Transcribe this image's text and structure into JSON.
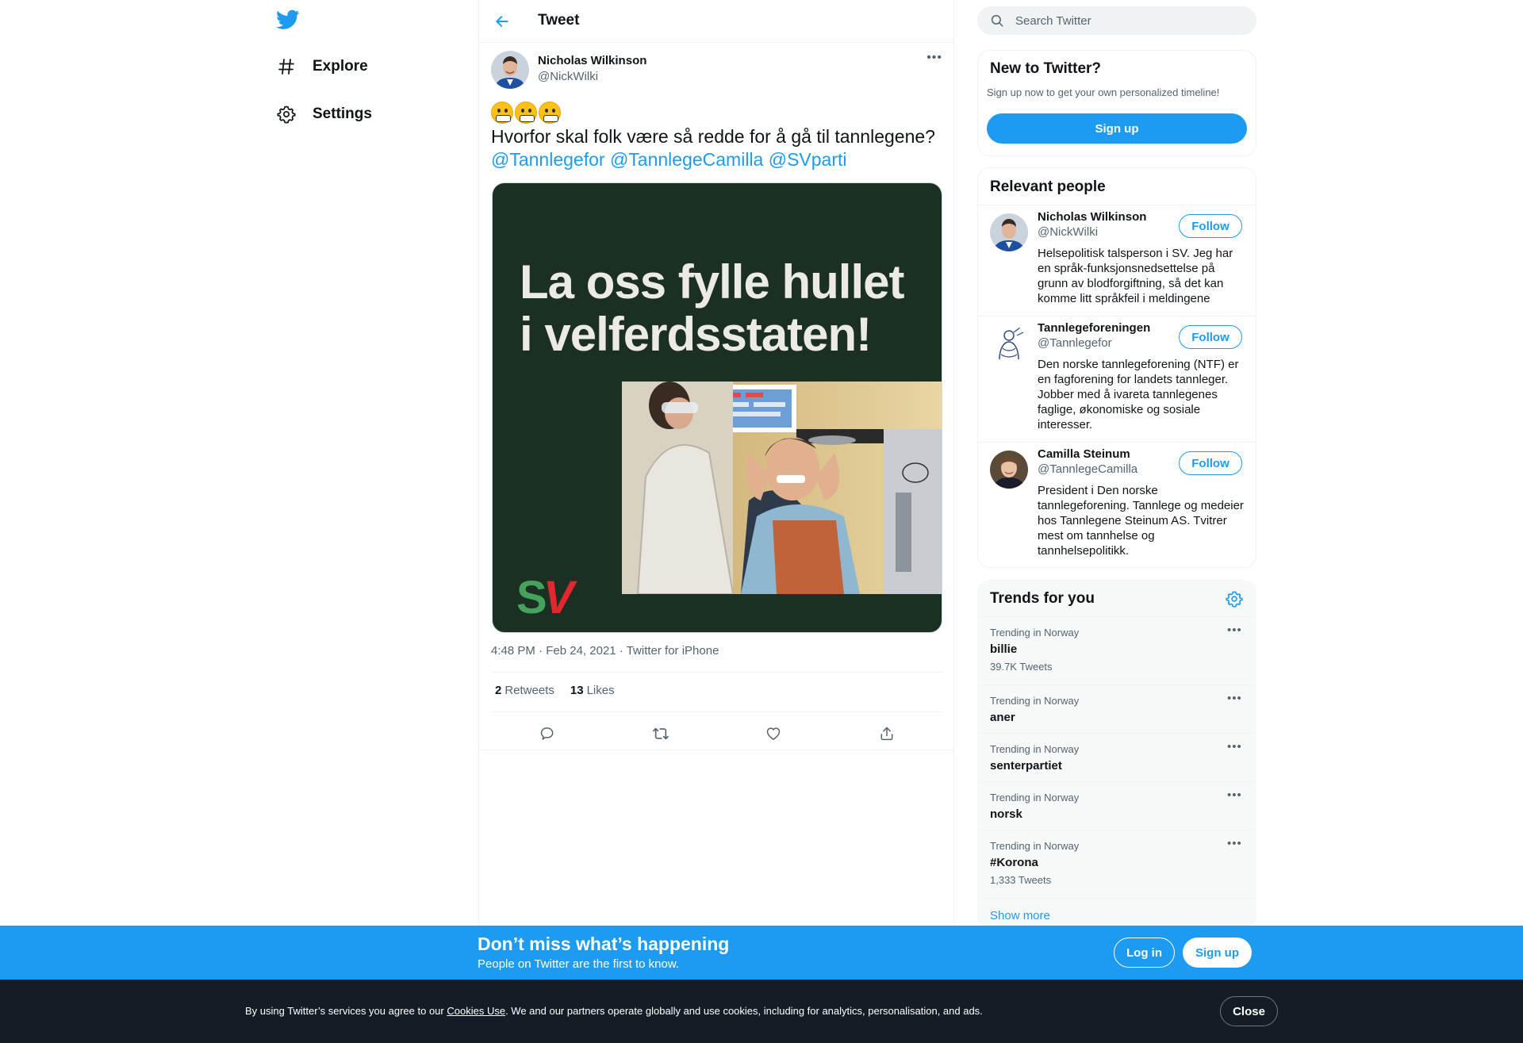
{
  "colors": {
    "brand": "#1d9bf0",
    "text": "#0f1419",
    "secondary": "#536471",
    "cookie_bg": "#141d26"
  },
  "nav": {
    "logo_icon": "twitter-bird-icon",
    "items": [
      {
        "label": "Explore",
        "icon": "hashtag-icon"
      },
      {
        "label": "Settings",
        "icon": "gear-icon"
      }
    ]
  },
  "header": {
    "title": "Tweet",
    "back_icon": "arrow-left-icon"
  },
  "tweet": {
    "author_name": "Nicholas Wilkinson",
    "author_handle": "@NickWilki",
    "text_line1": "Hvorfor skal folk være så redde for å gå til tannlegene?",
    "mentions": [
      "@Tannlegefor",
      "@TannlegeCamilla",
      "@SVparti"
    ],
    "media": {
      "headline_line1": "La oss fylle hullet",
      "headline_line2": "i velferdsstaten!",
      "logo_s": "S",
      "logo_v": "V"
    },
    "time": "4:48 PM",
    "date": "Feb 24, 2021",
    "source": "Twitter for iPhone",
    "retweets": "2",
    "retweets_label": "Retweets",
    "likes": "13",
    "likes_label": "Likes"
  },
  "search": {
    "placeholder": "Search Twitter"
  },
  "new_to_twitter": {
    "title": "New to Twitter?",
    "subtitle": "Sign up now to get your own personalized timeline!",
    "button": "Sign up"
  },
  "relevant": {
    "title": "Relevant people",
    "follow_label": "Follow",
    "people": [
      {
        "name": "Nicholas Wilkinson",
        "handle": "@NickWilki",
        "bio": "Helsepolitisk talsperson i SV. Jeg har en språk-funksjonsnedsettelse på grunn av blodforgiftning, så det kan komme litt språkfeil i meldingene"
      },
      {
        "name": "Tannlegeforeningen",
        "handle": "@Tannlegefor",
        "bio": "Den norske tannlegeforening (NTF) er en fagforening for landets tannleger. Jobber med å ivareta tannlegenes faglige, økonomiske og sosiale interesser."
      },
      {
        "name": "Camilla Steinum",
        "handle": "@TannlegeCamilla",
        "bio": "President i Den norske tannlegeforening. Tannlege og medeier hos Tannlegene Steinum AS. Tvitrer mest om tannhelse og tannhelsepolitikk."
      }
    ]
  },
  "trends": {
    "title": "Trends for you",
    "items": [
      {
        "context": "Trending in Norway",
        "name": "billie",
        "count": "39.7K Tweets"
      },
      {
        "context": "Trending in Norway",
        "name": "aner",
        "count": ""
      },
      {
        "context": "Trending in Norway",
        "name": "senterpartiet",
        "count": ""
      },
      {
        "context": "Trending in Norway",
        "name": "norsk",
        "count": ""
      },
      {
        "context": "Trending in Norway",
        "name": "#Korona",
        "count": "1,333 Tweets"
      }
    ],
    "show_more": "Show more"
  },
  "promo": {
    "title": "Don’t miss what’s happening",
    "subtitle": "People on Twitter are the first to know.",
    "login": "Log in",
    "signup": "Sign up"
  },
  "cookie": {
    "prefix": "By using Twitter’s services you agree to our ",
    "link": "Cookies Use",
    "suffix": ". We and our partners operate globally and use cookies, including for analytics, personalisation, and ads.",
    "close": "Close"
  }
}
